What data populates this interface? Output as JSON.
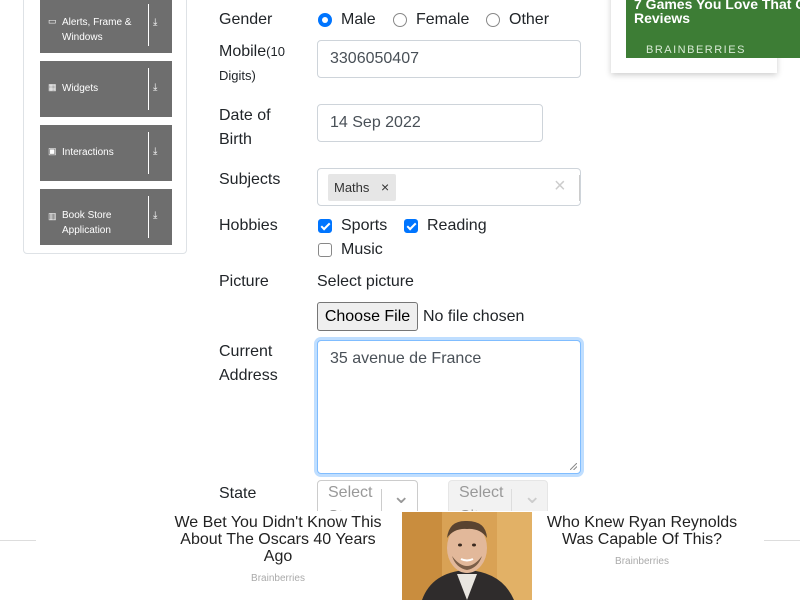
{
  "sidebar": {
    "items": [
      {
        "icon": "window-icon",
        "icon_glyph": "▭",
        "label": "Alerts, Frame & Windows"
      },
      {
        "icon": "widgets-icon",
        "icon_glyph": "▦",
        "label": "Widgets"
      },
      {
        "icon": "interactions-icon",
        "icon_glyph": "▣",
        "label": "Interactions"
      },
      {
        "icon": "book-icon",
        "icon_glyph": "▥",
        "label": "Book Store Application"
      }
    ],
    "arrow_glyph": "⤓"
  },
  "form": {
    "gender": {
      "label": "Gender",
      "options": [
        "Male",
        "Female",
        "Other"
      ],
      "selected": "Male"
    },
    "mobile": {
      "label": "Mobile",
      "label_note": "(10 Digits)",
      "value": "3306050407"
    },
    "dob": {
      "label_line1": "Date of",
      "label_line2": "Birth",
      "value": "14 Sep 2022"
    },
    "subjects": {
      "label": "Subjects",
      "tags": [
        "Maths"
      ],
      "tag_remove_glyph": "×",
      "clear_glyph": "×"
    },
    "hobbies": {
      "label": "Hobbies",
      "options": [
        "Sports",
        "Reading",
        "Music"
      ],
      "checked": [
        "Sports",
        "Reading"
      ]
    },
    "picture": {
      "label": "Picture",
      "prompt": "Select picture",
      "button_label": "Choose File",
      "status": "No file chosen"
    },
    "address": {
      "label_line1": "Current",
      "label_line2": "Address",
      "value": "35 avenue de France"
    },
    "state": {
      "label": "State",
      "state_placeholder_line1": "Select",
      "state_placeholder_line2": "State",
      "city_placeholder_line1": "Select",
      "city_placeholder_line2": "City",
      "chevron_glyph": "⌄"
    }
  },
  "ads": {
    "top_right": {
      "headline_line1": "7 Games You Love That C",
      "headline_line2": "Reviews",
      "source": "BRAINBERRIES"
    },
    "bottom": [
      {
        "headline": "We Bet You Didn't Know This About The Oscars 40 Years Ago",
        "source": "Brainberries"
      },
      {
        "headline": "Who Knew Ryan Reynolds Was Capable Of This?",
        "source": "Brainberries"
      }
    ]
  },
  "colors": {
    "accent": "#0075ff",
    "sidebar_item": "#6e6e6e",
    "ad_green": "#3d7d35"
  }
}
